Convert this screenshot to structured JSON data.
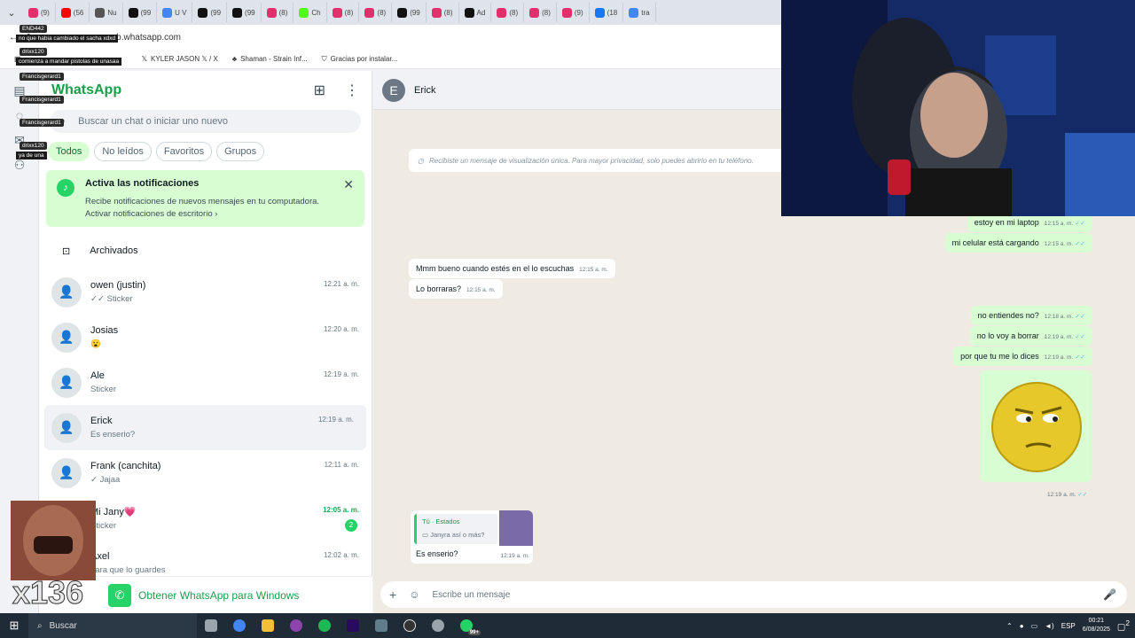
{
  "browser": {
    "tabs": [
      {
        "icon": "instagram-icon",
        "label": "(9)",
        "color": "#e1306c"
      },
      {
        "icon": "youtube-icon",
        "label": "(56",
        "color": "#ff0000"
      },
      {
        "icon": "chess-icon",
        "label": "Nu",
        "color": "#555555"
      },
      {
        "icon": "tiktok-icon",
        "label": "(99",
        "color": "#111111"
      },
      {
        "icon": "google-icon",
        "label": "U V",
        "color": "#4285f4"
      },
      {
        "icon": "tiktok-icon",
        "label": "(99",
        "color": "#111111"
      },
      {
        "icon": "tiktok-icon",
        "label": "(99",
        "color": "#111111"
      },
      {
        "icon": "instagram-icon",
        "label": "(8)",
        "color": "#e1306c"
      },
      {
        "icon": "kick-icon",
        "label": "Ch",
        "color": "#53fc18"
      },
      {
        "icon": "instagram-icon",
        "label": "(8)",
        "color": "#e1306c"
      },
      {
        "icon": "instagram-icon",
        "label": "(8)",
        "color": "#e1306c"
      },
      {
        "icon": "tiktok-icon",
        "label": "(99",
        "color": "#111111"
      },
      {
        "icon": "instagram-icon",
        "label": "(8)",
        "color": "#e1306c"
      },
      {
        "icon": "tiktok-icon",
        "label": "Ad",
        "color": "#111111"
      },
      {
        "icon": "instagram-icon",
        "label": "(8)",
        "color": "#e1306c"
      },
      {
        "icon": "instagram-icon",
        "label": "(8)",
        "color": "#e1306c"
      },
      {
        "icon": "instagram-icon",
        "label": "(9)",
        "color": "#e1306c"
      },
      {
        "icon": "facebook-icon",
        "label": "(18",
        "color": "#1877f2"
      },
      {
        "icon": "google-icon",
        "label": "tra",
        "color": "#4285f4"
      }
    ],
    "url": "web.whatsapp.com",
    "bookmarks": [
      {
        "icon": "x-icon",
        "label": "KYLER JASON 𝕏 / X"
      },
      {
        "icon": "leaf-icon",
        "label": "Shaman - Strain Inf..."
      },
      {
        "icon": "shield-icon",
        "label": "Gracias por instalar..."
      }
    ]
  },
  "stream_chat": [
    {
      "user": "END442",
      "message": "no que habia cambiado el sacha xdxd"
    },
    {
      "user": "drixx120",
      "message": "comienza a mandar pistolas de unasaa"
    },
    {
      "user": "Francisgerard1",
      "message": ""
    },
    {
      "user": "Francisgerard1",
      "message": ""
    },
    {
      "user": "Francisgerard1",
      "message": ""
    },
    {
      "user": "drixx120",
      "message": "ya de una"
    }
  ],
  "whatsapp": {
    "title": "WhatsApp",
    "search_placeholder": "Buscar un chat o iniciar uno nuevo",
    "filters": [
      {
        "label": "Todos",
        "active": true
      },
      {
        "label": "No leídos",
        "active": false
      },
      {
        "label": "Favoritos",
        "active": false
      },
      {
        "label": "Grupos",
        "active": false
      }
    ],
    "notification": {
      "title": "Activa las notificaciones",
      "body": "Recibe notificaciones de nuevos mensajes en tu computadora.",
      "link": "Activar notificaciones de escritorio ›"
    },
    "archived_label": "Archivados",
    "chats": [
      {
        "name": "owen (justin)",
        "last": "✓✓ Sticker",
        "time": "12:21 a. m.",
        "unread": null
      },
      {
        "name": "Josias",
        "last": "😮",
        "time": "12:20 a. m.",
        "unread": null
      },
      {
        "name": "Ale",
        "last": "Sticker",
        "time": "12:19 a. m.",
        "unread": null
      },
      {
        "name": "Erick",
        "last": "Es enserio?",
        "time": "12:19 a. m.",
        "unread": null
      },
      {
        "name": "Frank (canchita)",
        "last": "✓ Jajaa",
        "time": "12:11 a. m.",
        "unread": null
      },
      {
        "name": "Mi Jany💗",
        "last": "Sticker",
        "time": "12:05 a. m.",
        "unread": "2"
      },
      {
        "name": "Axel",
        "last": "para que lo guardes",
        "time": "12:02 a. m.",
        "unread": null
      }
    ],
    "get_app": "Obtener WhatsApp para Windows",
    "conversation": {
      "contact": "Erick",
      "system_notice": "Recibiste un mensaje de visualización única. Para mayor privacidad, solo puedes abrirlo en tu teléfono.",
      "messages": [
        {
          "dir": "out",
          "text": "estoy en mi laptop",
          "time": "12:15 a. m."
        },
        {
          "dir": "out",
          "text": "mi celular está cargando",
          "time": "12:15 a. m."
        },
        {
          "dir": "in",
          "text": "Mmm bueno cuando estés en el lo escuchas",
          "time": "12:15 a. m."
        },
        {
          "dir": "in",
          "text": "Lo borraras?",
          "time": "12:15 a. m."
        },
        {
          "dir": "out",
          "text": "no entiendes no?",
          "time": "12:18 a. m."
        },
        {
          "dir": "out",
          "text": "no lo voy a borrar",
          "time": "12:19 a. m."
        },
        {
          "dir": "out",
          "text": "por que tu me lo dices",
          "time": "12:19 a. m."
        }
      ],
      "sticker_time": "12:19 a. m.",
      "reply": {
        "quote_author": "Tú · Estados",
        "quote_text": "Janyra así o más?",
        "text": "Es enserio?",
        "time": "12:19 a. m."
      },
      "composer_placeholder": "Escribe un mensaje"
    }
  },
  "taskbar": {
    "search": "Buscar",
    "badge": "99+",
    "language": "ESP",
    "time": "00:21",
    "date": "6/08/2025",
    "notifications": "2"
  },
  "stream_counter": "x136",
  "colors": {
    "accent": "#25d366",
    "bubble_out": "#d9fdd3",
    "tick": "#53bdeb"
  }
}
